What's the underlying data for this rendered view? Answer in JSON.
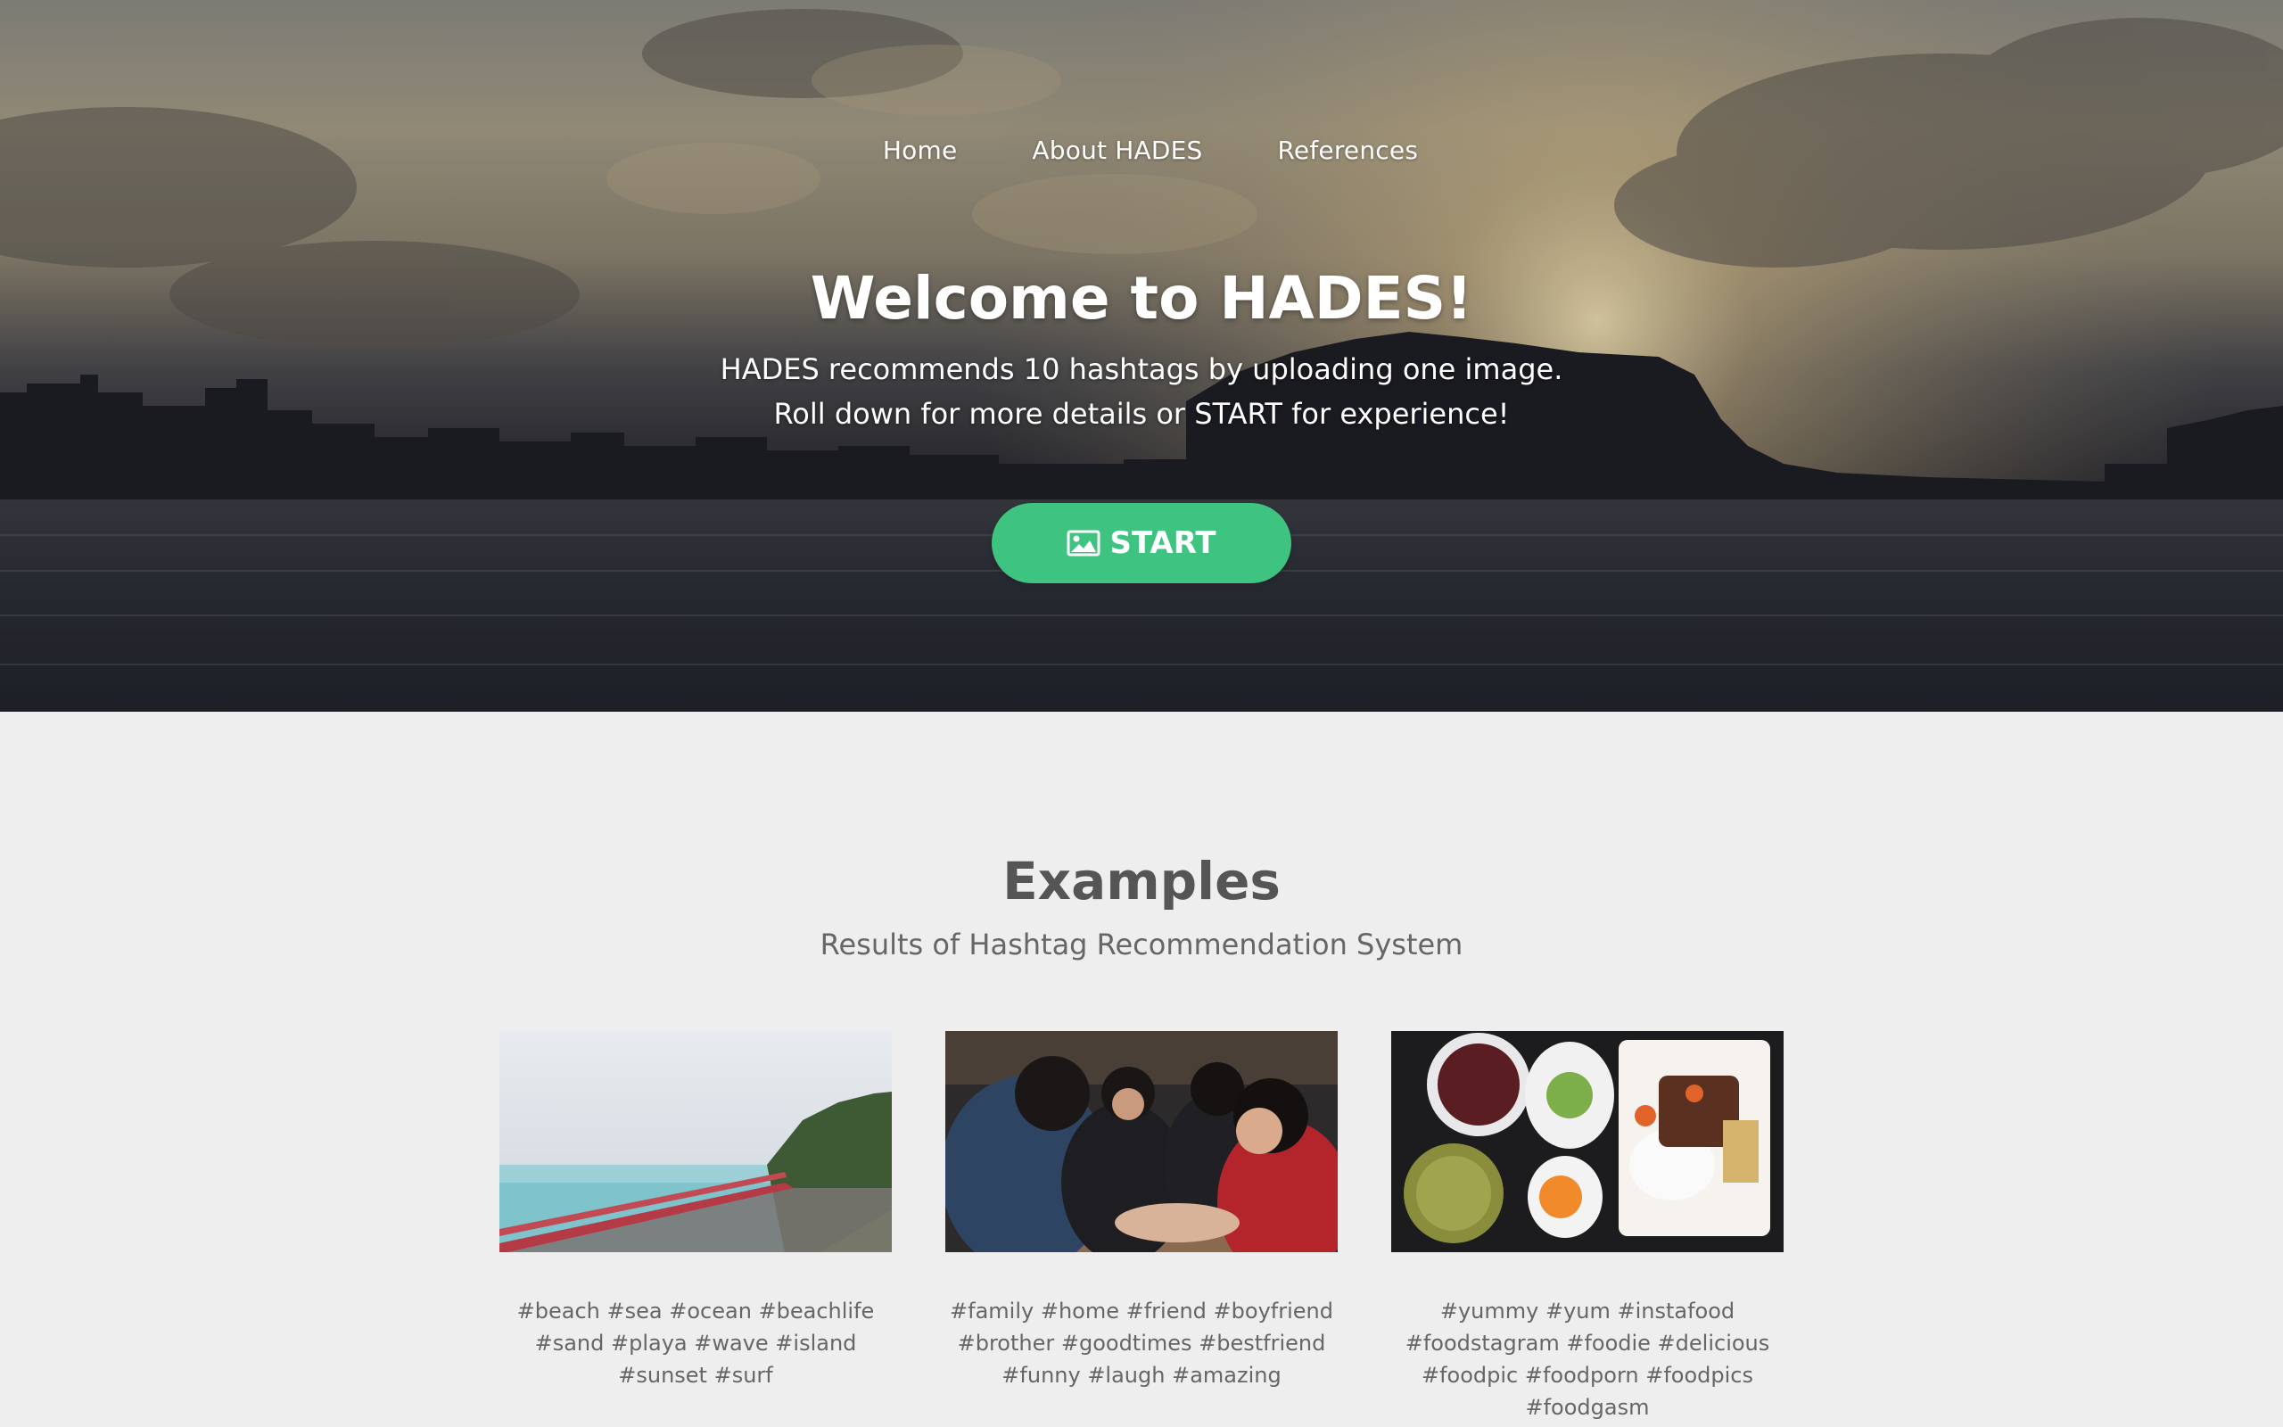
{
  "nav": {
    "items": [
      "Home",
      "About HADES",
      "References"
    ]
  },
  "hero": {
    "title": "Welcome to HADES!",
    "subtitle_line1": "HADES recommends 10 hashtags by uploading one image.",
    "subtitle_line2": "Roll down for more details or START for experience!",
    "start_label": "START",
    "start_icon": "image-icon",
    "accent_color": "#3fc380"
  },
  "examples": {
    "title": "Examples",
    "subtitle": "Results of Hashtag Recommendation System",
    "cards": [
      {
        "image": "beach-coast-photo",
        "tags": "#beach #sea #ocean #beachlife #sand #playa #wave #island #sunset #surf"
      },
      {
        "image": "friends-playing-cards-photo",
        "tags": "#family #home #friend #boyfriend #brother #goodtimes #bestfriend #funny #laugh #amazing"
      },
      {
        "image": "food-meal-photo",
        "tags": "#yummy #yum #instafood #foodstagram #foodie #delicious #foodpic #foodporn #foodpics #foodgasm"
      }
    ]
  }
}
